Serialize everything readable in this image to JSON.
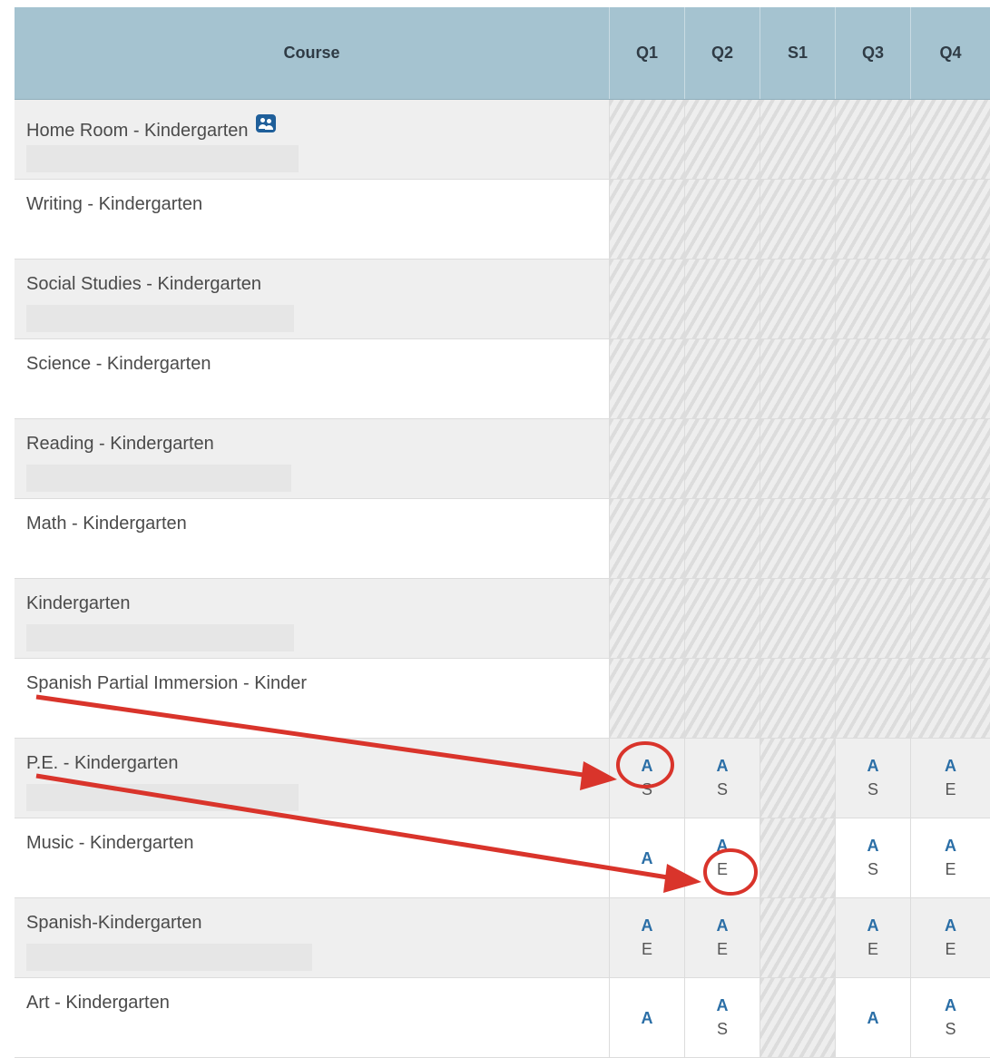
{
  "columns": {
    "course": "Course",
    "q1": "Q1",
    "q2": "Q2",
    "s1": "S1",
    "q3": "Q3",
    "q4": "Q4"
  },
  "rows": [
    {
      "name": "Home Room - Kindergarten",
      "icon": "team-icon",
      "redact_w": 300,
      "cells": [
        "h",
        "h",
        "h",
        "h",
        "h"
      ]
    },
    {
      "name": "Writing - Kindergarten",
      "redact_w": 0,
      "cells": [
        "h",
        "h",
        "h",
        "h",
        "h"
      ]
    },
    {
      "name": "Social Studies - Kindergarten",
      "redact_w": 295,
      "cells": [
        "h",
        "h",
        "h",
        "h",
        "h"
      ]
    },
    {
      "name": "Science - Kindergarten",
      "redact_w": 0,
      "cells": [
        "h",
        "h",
        "h",
        "h",
        "h"
      ]
    },
    {
      "name": "Reading - Kindergarten",
      "redact_w": 292,
      "cells": [
        "h",
        "h",
        "h",
        "h",
        "h"
      ]
    },
    {
      "name": "Math - Kindergarten",
      "redact_w": 0,
      "cells": [
        "h",
        "h",
        "h",
        "h",
        "h"
      ]
    },
    {
      "name": "Kindergarten",
      "redact_w": 295,
      "cells": [
        "h",
        "h",
        "h",
        "h",
        "h"
      ]
    },
    {
      "name": "Spanish Partial Immersion - Kinder",
      "redact_w": 0,
      "cells": [
        "h",
        "h",
        "h",
        "h",
        "h"
      ]
    },
    {
      "name": "P.E. - Kindergarten",
      "redact_w": 300,
      "cells": [
        [
          "A",
          "S"
        ],
        [
          "A",
          "S"
        ],
        "h",
        [
          "A",
          "S"
        ],
        [
          "A",
          "E"
        ]
      ]
    },
    {
      "name": "Music - Kindergarten",
      "redact_w": 0,
      "cells": [
        [
          "A",
          ""
        ],
        [
          "A",
          "E"
        ],
        "h",
        [
          "A",
          "S"
        ],
        [
          "A",
          "E"
        ]
      ]
    },
    {
      "name": "Spanish-Kindergarten",
      "redact_w": 315,
      "cells": [
        [
          "A",
          "E"
        ],
        [
          "A",
          "E"
        ],
        "h",
        [
          "A",
          "E"
        ],
        [
          "A",
          "E"
        ]
      ]
    },
    {
      "name": "Art - Kindergarten",
      "redact_w": 0,
      "cells": [
        [
          "A",
          ""
        ],
        [
          "A",
          "S"
        ],
        "h",
        [
          "A",
          ""
        ],
        [
          "A",
          "S"
        ]
      ]
    }
  ],
  "annotation_color": "#d9342b"
}
